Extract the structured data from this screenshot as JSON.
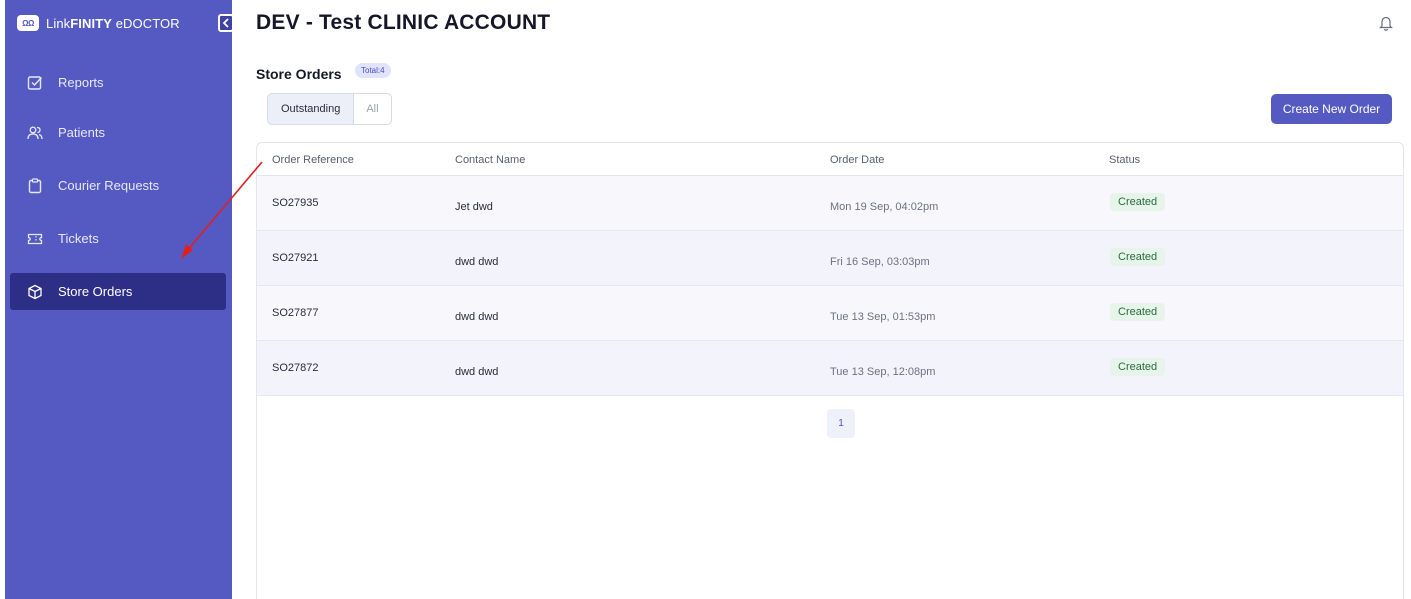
{
  "brand": {
    "logo_text": "ΩΩ",
    "name_prefix": "Link",
    "name_bold": "FINITY",
    "name_suffix": " eDOCTOR"
  },
  "sidebar": {
    "items": [
      {
        "label": "Reports",
        "icon": "checkbox-icon"
      },
      {
        "label": "Patients",
        "icon": "users-icon"
      },
      {
        "label": "Courier Requests",
        "icon": "clipboard-icon"
      },
      {
        "label": "Tickets",
        "icon": "ticket-icon"
      },
      {
        "label": "Store Orders",
        "icon": "box-icon",
        "active": true
      }
    ]
  },
  "header": {
    "title": "DEV - Test CLINIC ACCOUNT"
  },
  "section": {
    "title": "Store Orders",
    "total_badge": "Total:4"
  },
  "filters": {
    "outstanding": "Outstanding",
    "all": "All",
    "selected": "Outstanding"
  },
  "actions": {
    "create": "Create New Order"
  },
  "table": {
    "columns": [
      "Order Reference",
      "Contact Name",
      "Order Date",
      "Status"
    ],
    "rows": [
      {
        "ref": "SO27935",
        "name": "Jet dwd",
        "date": "Mon 19 Sep, 04:02pm",
        "status": "Created"
      },
      {
        "ref": "SO27921",
        "name": "dwd dwd",
        "date": "Fri 16 Sep, 03:03pm",
        "status": "Created"
      },
      {
        "ref": "SO27877",
        "name": "dwd dwd",
        "date": "Tue 13 Sep, 01:53pm",
        "status": "Created"
      },
      {
        "ref": "SO27872",
        "name": "dwd dwd",
        "date": "Tue 13 Sep, 12:08pm",
        "status": "Created"
      }
    ]
  },
  "pagination": {
    "current_page": "1"
  },
  "colors": {
    "sidebar": "#5559c2",
    "active_nav": "#2d2f86",
    "accent": "#5559c2",
    "annotation_arrow": "#e02020",
    "status_bg": "#e6f4ea"
  }
}
